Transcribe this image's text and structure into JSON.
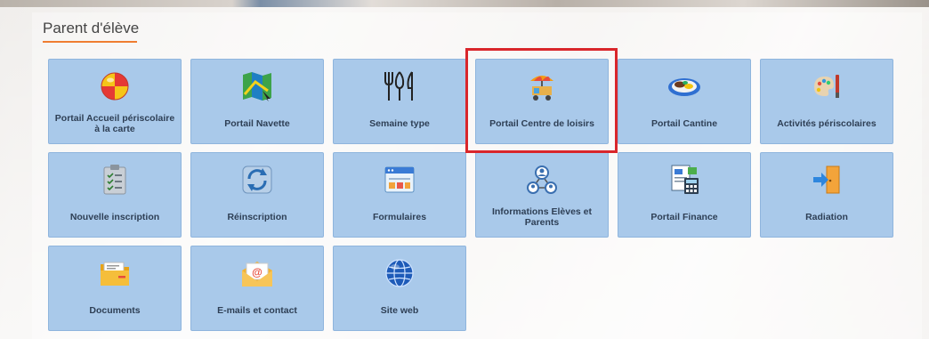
{
  "section": {
    "title": "Parent d'élève"
  },
  "tiles": [
    {
      "label": "Portail Accueil périscolaire à la carte",
      "icon": "beach-ball-icon"
    },
    {
      "label": "Portail Navette",
      "icon": "map-icon"
    },
    {
      "label": "Semaine type",
      "icon": "cutlery-icon"
    },
    {
      "label": "Portail Centre de loisirs",
      "icon": "food-cart-icon"
    },
    {
      "label": "Portail Cantine",
      "icon": "meal-plate-icon"
    },
    {
      "label": "Activités périscolaires",
      "icon": "paint-palette-icon"
    },
    {
      "label": "Nouvelle inscription",
      "icon": "clipboard-checklist-icon"
    },
    {
      "label": "Réinscription",
      "icon": "refresh-arrows-icon"
    },
    {
      "label": "Formulaires",
      "icon": "form-window-icon"
    },
    {
      "label": "Informations Elèves et Parents",
      "icon": "people-network-icon"
    },
    {
      "label": "Portail Finance",
      "icon": "invoice-calculator-icon"
    },
    {
      "label": "Radiation",
      "icon": "exit-door-icon"
    },
    {
      "label": "Documents",
      "icon": "folder-icon"
    },
    {
      "label": "E-mails et contact",
      "icon": "envelope-at-icon"
    },
    {
      "label": "Site web",
      "icon": "globe-icon"
    }
  ],
  "highlighted_tile": "Portail Centre de loisirs",
  "colors": {
    "tile": "#a9c9ea",
    "tile_text": "#2e3f55",
    "accent": "#ef7d31",
    "highlight": "#d9262b"
  }
}
